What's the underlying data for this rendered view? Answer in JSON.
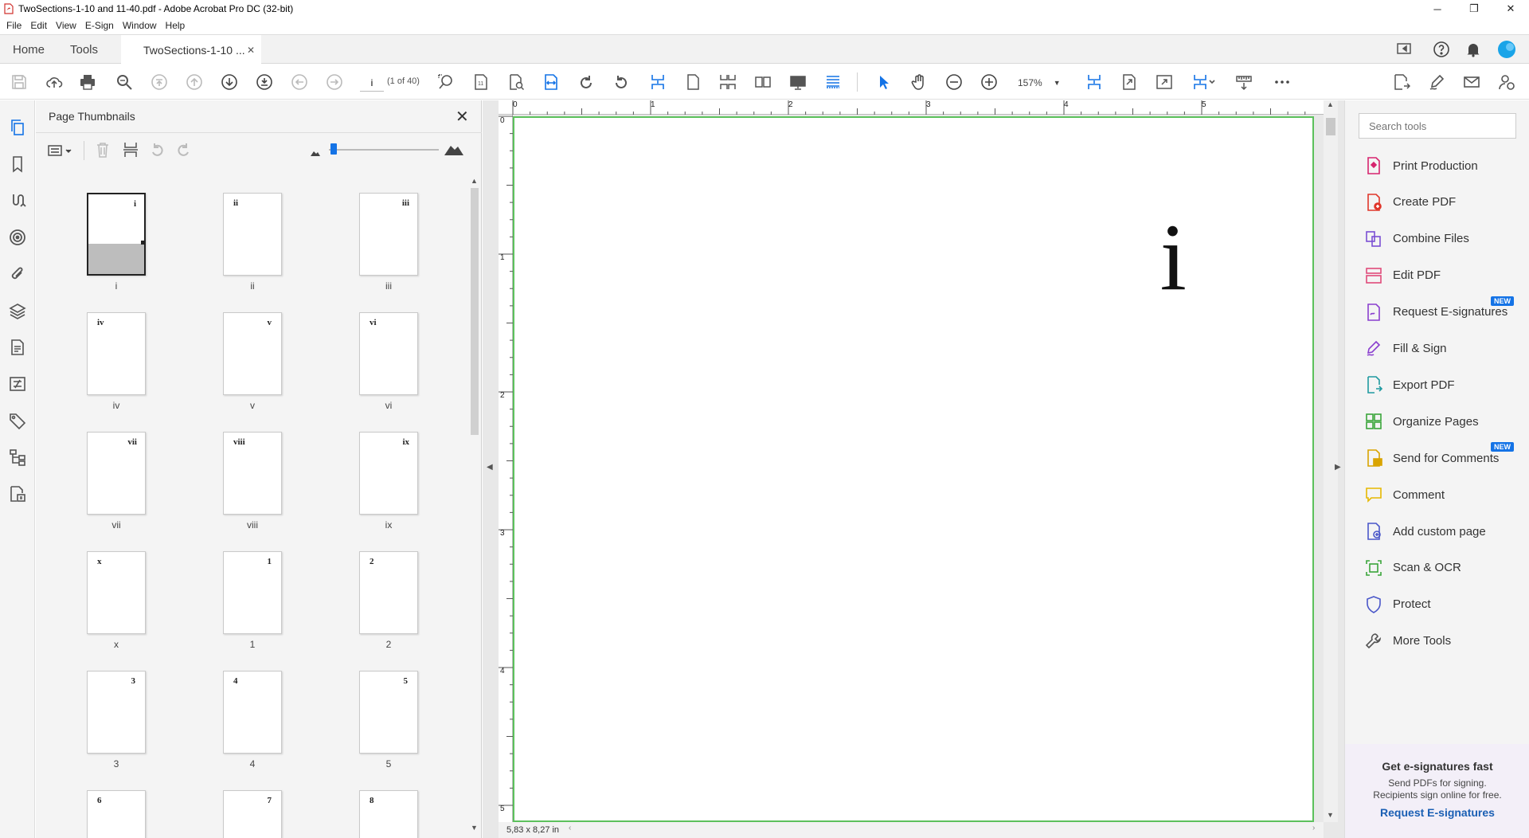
{
  "window": {
    "title": "TwoSections-1-10 and 11-40.pdf - Adobe Acrobat Pro DC (32-bit)"
  },
  "menu": [
    "File",
    "Edit",
    "View",
    "E-Sign",
    "Window",
    "Help"
  ],
  "tabs": {
    "home": "Home",
    "tools": "Tools",
    "document": "TwoSections-1-10 ...",
    "close": "✕"
  },
  "toolbar": {
    "page_input": "i",
    "page_count": "(1 of 40)",
    "zoom": "157%"
  },
  "thumbnails": {
    "title": "Page Thumbnails",
    "close": "✕",
    "pages": [
      {
        "label": "i",
        "num": "i",
        "align": "right"
      },
      {
        "label": "ii",
        "num": "ii",
        "align": "left"
      },
      {
        "label": "iii",
        "num": "iii",
        "align": "right"
      },
      {
        "label": "iv",
        "num": "iv",
        "align": "left"
      },
      {
        "label": "v",
        "num": "v",
        "align": "right"
      },
      {
        "label": "vi",
        "num": "vi",
        "align": "left"
      },
      {
        "label": "vii",
        "num": "vii",
        "align": "right"
      },
      {
        "label": "viii",
        "num": "viii",
        "align": "left"
      },
      {
        "label": "ix",
        "num": "ix",
        "align": "right"
      },
      {
        "label": "x",
        "num": "x",
        "align": "left"
      },
      {
        "label": "1",
        "num": "1",
        "align": "right"
      },
      {
        "label": "2",
        "num": "2",
        "align": "left"
      },
      {
        "label": "3",
        "num": "3",
        "align": "right"
      },
      {
        "label": "4",
        "num": "4",
        "align": "left"
      },
      {
        "label": "5",
        "num": "5",
        "align": "right"
      },
      {
        "label": "",
        "num": "6",
        "align": "left"
      },
      {
        "label": "",
        "num": "7",
        "align": "right"
      },
      {
        "label": "",
        "num": "8",
        "align": "left"
      }
    ]
  },
  "document": {
    "page_letter": "i",
    "ruler_top": [
      "0",
      "1",
      "2",
      "3",
      "4",
      "5"
    ],
    "ruler_left": [
      "0",
      "1",
      "2",
      "3",
      "4",
      "5"
    ],
    "page_size": "5,83 x 8,27 in"
  },
  "right_panel": {
    "search_placeholder": "Search tools",
    "tools": [
      {
        "label": "Print Production",
        "color": "#d6246e",
        "badge": ""
      },
      {
        "label": "Create PDF",
        "color": "#e0362a",
        "badge": ""
      },
      {
        "label": "Combine Files",
        "color": "#7b4fd4",
        "badge": ""
      },
      {
        "label": "Edit PDF",
        "color": "#e04a7a",
        "badge": ""
      },
      {
        "label": "Request E-signatures",
        "color": "#8a3fcf",
        "badge": "NEW"
      },
      {
        "label": "Fill & Sign",
        "color": "#8a3fcf",
        "badge": ""
      },
      {
        "label": "Export PDF",
        "color": "#1f9aa0",
        "badge": ""
      },
      {
        "label": "Organize Pages",
        "color": "#3aa53a",
        "badge": ""
      },
      {
        "label": "Send for Comments",
        "color": "#d9a400",
        "badge": "NEW"
      },
      {
        "label": "Comment",
        "color": "#e6b800",
        "badge": ""
      },
      {
        "label": "Add custom page",
        "color": "#4a57c9",
        "badge": ""
      },
      {
        "label": "Scan & OCR",
        "color": "#3aa53a",
        "badge": ""
      },
      {
        "label": "Protect",
        "color": "#4a57c9",
        "badge": ""
      },
      {
        "label": "More Tools",
        "color": "#555555",
        "badge": ""
      }
    ],
    "promo": {
      "title": "Get e-signatures fast",
      "text": "Send PDFs for signing.\nRecipients sign online for free.",
      "link": "Request E-signatures"
    }
  },
  "colors": {
    "accent": "#1473e6",
    "page_border": "#5cc15c"
  }
}
